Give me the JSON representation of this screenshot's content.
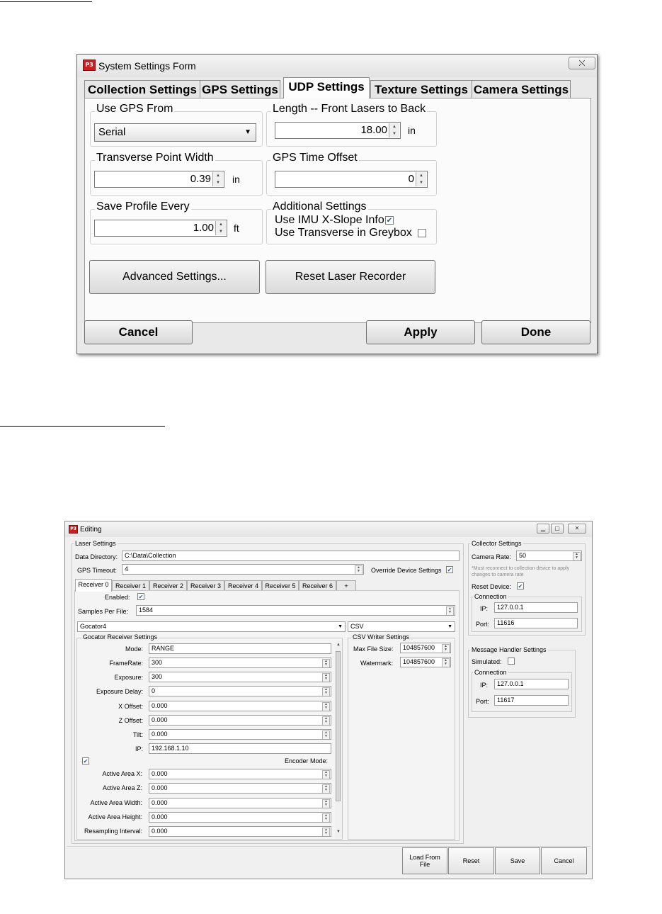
{
  "window1": {
    "title": "System Settings Form",
    "close_glyph": "⛌",
    "tabs": [
      "Collection Settings",
      "GPS Settings",
      "UDP Settings",
      "Texture Settings",
      "Camera Settings"
    ],
    "active_tab": "UDP Settings",
    "use_gps_from": {
      "label": "Use GPS From",
      "value": "Serial"
    },
    "length_front_to_back": {
      "label": "Length -- Front Lasers to Back",
      "value": "18.00",
      "unit": "in"
    },
    "transverse_point_width": {
      "label": "Transverse Point Width",
      "value": "0.39",
      "unit": "in"
    },
    "gps_time_offset": {
      "label": "GPS Time Offset",
      "value": "0"
    },
    "save_profile_every": {
      "label": "Save Profile Every",
      "value": "1.00",
      "unit": "ft"
    },
    "additional_settings": {
      "label": "Additional Settings",
      "use_imu": {
        "label": "Use IMU X-Slope Info",
        "checked": true
      },
      "use_transverse": {
        "label": "Use Transverse in Greybox",
        "checked": false
      }
    },
    "advanced_button": "Advanced Settings...",
    "reset_laser_button": "Reset Laser Recorder",
    "cancel_button": "Cancel",
    "apply_button": "Apply",
    "done_button": "Done"
  },
  "window2": {
    "title": "Editing",
    "laser_settings": {
      "legend": "Laser Settings",
      "data_directory_label": "Data Directory:",
      "data_directory": "C:\\Data\\Collection",
      "gps_timeout_label": "GPS Timeout:",
      "gps_timeout": "4",
      "override_label": "Override Device Settings",
      "override_checked": true,
      "receiver_tabs": [
        "Receiver 0",
        "Receiver 1",
        "Receiver 2",
        "Receiver 3",
        "Receiver 4",
        "Receiver 5",
        "Receiver 6",
        "+"
      ],
      "enabled_label": "Enabled:",
      "enabled": true,
      "samples_per_file_label": "Samples Per File:",
      "samples_per_file": "1584",
      "receiver_type": "Gocator4",
      "writer_type": "CSV",
      "gocator_legend": "Gocator Receiver Settings",
      "gocator_fields": [
        {
          "label": "Mode:",
          "value": "RANGE",
          "spin": false
        },
        {
          "label": "FrameRate:",
          "value": "300",
          "spin": true
        },
        {
          "label": "Exposure:",
          "value": "300",
          "spin": true
        },
        {
          "label": "Exposure Delay:",
          "value": "0",
          "spin": true
        },
        {
          "label": "X Offset:",
          "value": "0.000",
          "spin": true
        },
        {
          "label": "Z Offset:",
          "value": "0.000",
          "spin": true
        },
        {
          "label": "Tilt:",
          "value": "0.000",
          "spin": true
        },
        {
          "label": "IP:",
          "value": "192.168.1.10",
          "spin": false
        }
      ],
      "encoder_mode_label": "Encoder Mode:",
      "encoder_checked": true,
      "active_area_fields": [
        {
          "label": "Active Area X:",
          "value": "0.000"
        },
        {
          "label": "Active Area Z:",
          "value": "0.000"
        },
        {
          "label": "Active Area Width:",
          "value": "0.000"
        },
        {
          "label": "Active Area Height:",
          "value": "0.000"
        },
        {
          "label": "Resampling Interval:",
          "value": "0.000"
        }
      ],
      "csv_legend": "CSV Writer Settings",
      "max_file_size_label": "Max File Size:",
      "max_file_size": "104857600",
      "watermark_label": "Watermark:",
      "watermark": "104857600"
    },
    "collector_settings": {
      "legend": "Collector Settings",
      "camera_rate_label": "Camera Rate:",
      "camera_rate": "50",
      "note": "*Must reconnect to collection device to apply changes to camera rate",
      "reset_device_label": "Reset Device:",
      "reset_device": true,
      "connection_legend": "Connection",
      "ip_label": "IP:",
      "ip": "127.0.0.1",
      "port_label": "Port:",
      "port": "11616"
    },
    "message_handler": {
      "legend": "Message Handler Settings",
      "simulated_label": "Simulated:",
      "simulated": false,
      "connection_legend": "Connection",
      "ip_label": "IP:",
      "ip": "127.0.0.1",
      "port_label": "Port:",
      "port": "11617"
    },
    "buttons": {
      "load": "Load From File",
      "reset": "Reset",
      "save": "Save",
      "cancel": "Cancel"
    }
  }
}
